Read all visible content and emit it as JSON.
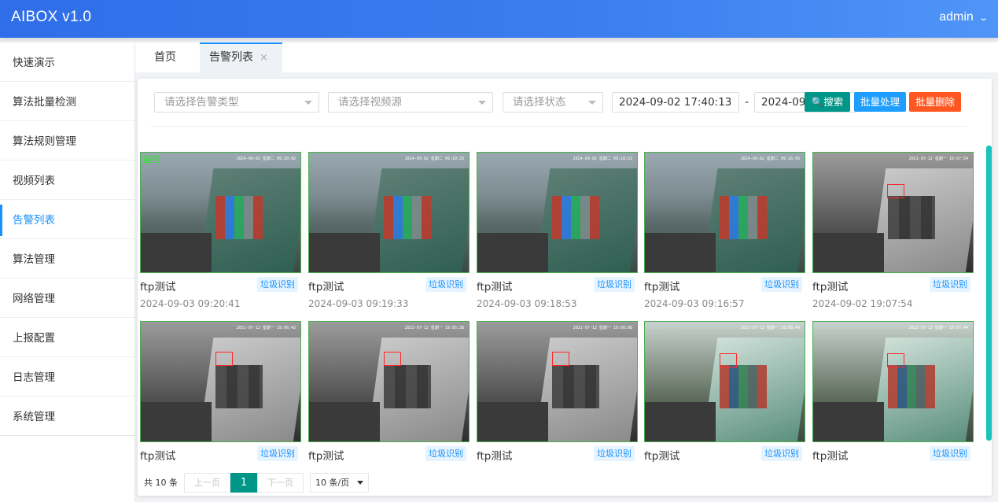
{
  "header": {
    "brand": "AIBOX v1.0",
    "user": "admin"
  },
  "sidebar": {
    "items": [
      {
        "label": "快速演示"
      },
      {
        "label": "算法批量检测"
      },
      {
        "label": "算法规则管理"
      },
      {
        "label": "视频列表"
      },
      {
        "label": "告警列表"
      },
      {
        "label": "算法管理"
      },
      {
        "label": "网络管理"
      },
      {
        "label": "上报配置"
      },
      {
        "label": "日志管理"
      },
      {
        "label": "系统管理"
      }
    ],
    "active": "告警列表"
  },
  "tabs": {
    "home": "首页",
    "current": "告警列表",
    "close": "×"
  },
  "filters": {
    "alarm_type_placeholder": "请选择告警类型",
    "video_source_placeholder": "请选择视频源",
    "status_placeholder": "请选择状态",
    "start_time": "2024-09-02 17:40:13",
    "separator": "-",
    "end_time": "2024-09-",
    "search_label": "搜索",
    "batch_process_label": "批量处理",
    "batch_delete_label": "批量删除"
  },
  "cards": [
    {
      "name": "ftp测试",
      "tag": "垃圾识别",
      "time": "2024-09-03 09:20:41",
      "osd": "画框",
      "stamp": "2024-09-02 星期二 09:20:42"
    },
    {
      "name": "ftp测试",
      "tag": "垃圾识别",
      "time": "2024-09-03 09:19:33",
      "stamp": "2024-09-02 星期二 09:19:33"
    },
    {
      "name": "ftp测试",
      "tag": "垃圾识别",
      "time": "2024-09-03 09:18:53",
      "stamp": "2024-09-02 星期二 09:18:53"
    },
    {
      "name": "ftp测试",
      "tag": "垃圾识别",
      "time": "2024-09-03 09:16:57",
      "stamp": "2024-09-02 星期二 09:16:56"
    },
    {
      "name": "ftp测试",
      "tag": "垃圾识别",
      "time": "2024-09-02 19:07:54",
      "stamp": "2021-07-12 星期一 19:07:54"
    },
    {
      "name": "ftp测试",
      "tag": "垃圾识别",
      "stamp": "2021-07-12 星期一 19:06:42"
    },
    {
      "name": "ftp测试",
      "tag": "垃圾识别",
      "stamp": "2021-07-12 星期一 19:05:38"
    },
    {
      "name": "ftp测试",
      "tag": "垃圾识别",
      "stamp": "2021-07-12 星期一 19:08:08"
    },
    {
      "name": "ftp测试",
      "tag": "垃圾识别",
      "stamp": "2021-07-12 星期一 19:08:40"
    },
    {
      "name": "ftp测试",
      "tag": "垃圾识别",
      "stamp": "2021-07-12 星期一 19:07:44"
    }
  ],
  "pagination": {
    "total": "共 10 条",
    "prev": "上一页",
    "current": "1",
    "next": "下一页",
    "page_size": "10 条/页"
  }
}
